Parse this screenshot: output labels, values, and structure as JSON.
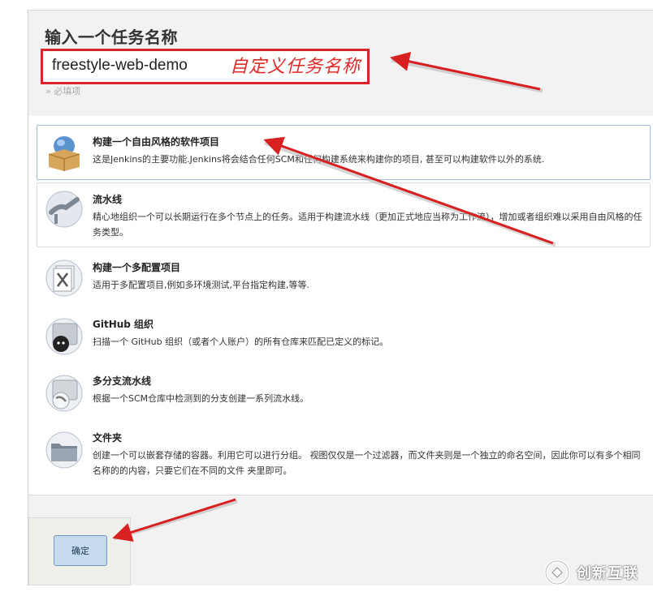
{
  "heading": "输入一个任务名称",
  "name_input": {
    "value": "freestyle-web-demo",
    "annotation": "自定义任务名称",
    "required_note": "» 必填项"
  },
  "types": [
    {
      "title": "构建一个自由风格的软件项目",
      "description": "这是Jenkins的主要功能.Jenkins将会结合任何SCM和任何构建系统来构建你的项目, 甚至可以构建软件以外的系统.",
      "icon": "freestyle-project-icon"
    },
    {
      "title": "流水线",
      "description": "精心地组织一个可以长期运行在多个节点上的任务。适用于构建流水线（更加正式地应当称为工作流），增加或者组织难以采用自由风格的任务类型。",
      "icon": "pipeline-icon"
    },
    {
      "title": "构建一个多配置项目",
      "description": "适用于多配置项目,例如多环境测试,平台指定构建,等等.",
      "icon": "multi-config-icon"
    },
    {
      "title": "GitHub 组织",
      "description": "扫描一个 GitHub 组织（或者个人账户）的所有仓库来匹配已定义的标记。",
      "icon": "github-organization-icon"
    },
    {
      "title": "多分支流水线",
      "description": "根据一个SCM仓库中检测到的分支创建一系列流水线。",
      "icon": "multibranch-pipeline-icon"
    },
    {
      "title": "文件夹",
      "description": "创建一个可以嵌套存储的容器。利用它可以进行分组。 视图仅仅是一个过滤器，而文件夹则是一个独立的命名空间，因此你可以有多个相同名称的的内容，只要它们在不同的文件 夹里即可。",
      "icon": "folder-icon"
    }
  ],
  "ok_button": "确定",
  "watermark": "创新互联",
  "colors": {
    "annotation_red": "#d6262b",
    "selected_border": "#a7bcd6",
    "button_bg": "#c7dbef"
  }
}
